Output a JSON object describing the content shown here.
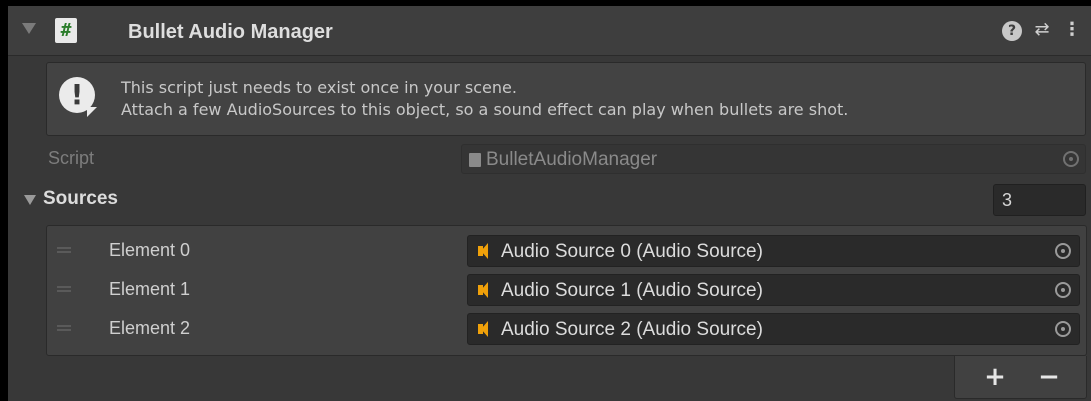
{
  "component": {
    "title": "Bullet Audio Manager",
    "script_icon_glyph": "#",
    "header_icons": {
      "help": "?",
      "presets": "⇄",
      "menu": "⋮"
    }
  },
  "help_box": {
    "line1": "This script just needs to exist once in your scene.",
    "line2": "Attach a few AudioSources to this object, so a sound effect can play when bullets are shot.",
    "icon_glyph": "!"
  },
  "script_field": {
    "label": "Script",
    "value": "BulletAudioManager"
  },
  "sources": {
    "label": "Sources",
    "count": "3",
    "elements": [
      {
        "label": "Element 0",
        "value": "Audio Source 0 (Audio Source)"
      },
      {
        "label": "Element 1",
        "value": "Audio Source 1 (Audio Source)"
      },
      {
        "label": "Element 2",
        "value": "Audio Source 2 (Audio Source)"
      }
    ],
    "add_label": "+",
    "remove_label": "−"
  },
  "colors": {
    "panel_bg": "#383838",
    "header_bg": "#3e3e3e",
    "field_bg": "#2a2a2a",
    "audio_icon": "#f0a10a",
    "script_icon_text": "#2b7d2b"
  }
}
